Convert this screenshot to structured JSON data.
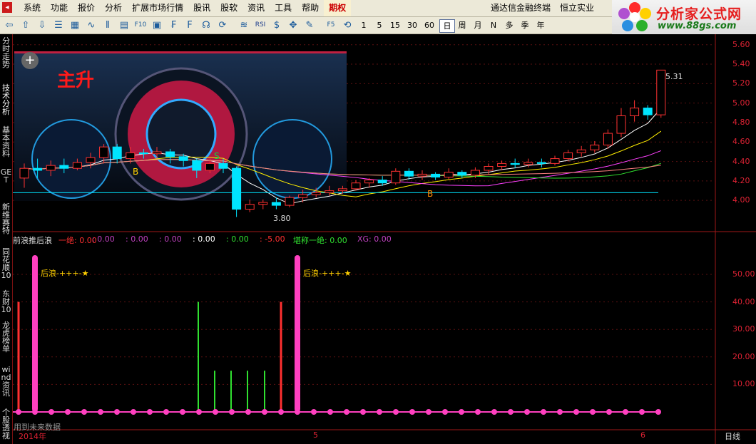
{
  "menu": {
    "back_icon": "back-arrow-icon",
    "items": [
      "系统",
      "功能",
      "报价",
      "分析",
      "扩展市场行情",
      "股讯",
      "股软",
      "资讯",
      "工具",
      "帮助"
    ],
    "highlight": "期权",
    "app_name": "通达信金融终端",
    "stock_name": "恒立实业"
  },
  "logo": {
    "main": "分析家公式网",
    "url": "www.88gs.com"
  },
  "toolbar": {
    "icons": [
      "back-icon",
      "up-arrow-icon",
      "down-arrow-icon",
      "list-icon",
      "grid-icon",
      "line-chart-icon",
      "candle-icon",
      "table-icon",
      "f10-icon",
      "detail-icon",
      "finance-icon",
      "f10-doc-icon",
      "news-icon",
      "refresh-icon",
      "wave-icon",
      "rsi-icon",
      "money-icon",
      "move-icon",
      "pen-icon",
      "f5-icon",
      "cycle-icon"
    ],
    "rsi_label": "RSI",
    "f5_label": "F5",
    "periods": [
      "1",
      "5",
      "15",
      "30",
      "60",
      "日",
      "周",
      "月",
      "N",
      "多",
      "季",
      "年"
    ],
    "selected_period": "日"
  },
  "sidebar": {
    "tabs": [
      "分时走势",
      "技术分析",
      "基本资料",
      "GET",
      "新维赛特",
      "同花顺10",
      "东财10",
      "龙虎榜单",
      "wind资讯",
      "个股透视"
    ],
    "selected": "技术分析"
  },
  "price_panel": {
    "high_label": "5.31",
    "low_label": "3.80",
    "buy_marks": [
      "B",
      "B"
    ],
    "sell_mark": "S",
    "overlay_title": "主升",
    "y_ticks": [
      "5.60",
      "5.40",
      "5.20",
      "5.00",
      "4.80",
      "4.60",
      "4.40",
      "4.20",
      "4.00"
    ]
  },
  "indicator_panel": {
    "name": "前浪推后浪",
    "readouts": [
      {
        "label": "一绝: 0.00",
        "color": "#ff3030"
      },
      {
        "label": ": 0.00",
        "color": "#c040c0"
      },
      {
        "label": ": 0.00",
        "color": "#c040c0"
      },
      {
        "label": ": 0.00",
        "color": "#c040c0"
      },
      {
        "label": ": 0.00",
        "color": "#ffffff"
      },
      {
        "label": ": 0.00",
        "color": "#30e030"
      },
      {
        "label": ": -5.00",
        "color": "#ff3030"
      },
      {
        "label": "堪称一绝: 0.00",
        "color": "#30e030"
      },
      {
        "label": "XG: 0.00",
        "color": "#c040c0"
      }
    ],
    "annotation": "后浪-+++-★",
    "future_note": "用到未来数据",
    "y_ticks": [
      "50.00",
      "40.00",
      "30.00",
      "20.00",
      "10.00"
    ]
  },
  "date_axis": {
    "year": "2014年",
    "months": [
      "5",
      "6"
    ]
  },
  "period_label": "日线",
  "colors": {
    "up": "#ff3232",
    "down": "#00e5ff",
    "bg": "#000000",
    "grid": "#8a1a1a"
  },
  "chart_data": [
    {
      "type": "candlestick",
      "title": "恒立实业 日线",
      "ylim": [
        3.8,
        5.65
      ],
      "series": [
        {
          "name": "price",
          "values": [
            [
              4.2,
              4.3,
              4.35,
              4.1
            ],
            [
              4.3,
              4.28,
              4.4,
              4.2
            ],
            [
              4.28,
              4.33,
              4.38,
              4.22
            ],
            [
              4.33,
              4.3,
              4.4,
              4.25
            ],
            [
              4.3,
              4.36,
              4.4,
              4.28
            ],
            [
              4.36,
              4.41,
              4.46,
              4.3
            ],
            [
              4.41,
              4.52,
              4.55,
              4.35
            ],
            [
              4.52,
              4.4,
              4.55,
              4.35
            ],
            [
              4.4,
              4.46,
              4.52,
              4.35
            ],
            [
              4.46,
              4.45,
              4.5,
              4.4
            ],
            [
              4.45,
              4.47,
              4.52,
              4.4
            ],
            [
              4.47,
              4.42,
              4.5,
              4.35
            ],
            [
              4.42,
              4.38,
              4.45,
              4.32
            ],
            [
              4.38,
              4.28,
              4.4,
              4.2
            ],
            [
              4.28,
              4.35,
              4.4,
              4.25
            ],
            [
              4.35,
              4.3,
              4.4,
              4.25
            ],
            [
              4.3,
              3.88,
              4.32,
              3.8
            ],
            [
              3.88,
              3.93,
              3.98,
              3.85
            ],
            [
              3.93,
              3.95,
              3.98,
              3.88
            ],
            [
              3.95,
              3.92,
              4.0,
              3.88
            ],
            [
              3.92,
              4.0,
              4.02,
              3.9
            ],
            [
              4.0,
              4.03,
              4.08,
              3.95
            ],
            [
              4.03,
              4.05,
              4.1,
              4.0
            ],
            [
              4.05,
              4.07,
              4.12,
              4.02
            ],
            [
              4.07,
              4.09,
              4.12,
              4.04
            ],
            [
              4.09,
              4.15,
              4.18,
              4.07
            ],
            [
              4.15,
              4.18,
              4.2,
              4.1
            ],
            [
              4.18,
              4.15,
              4.22,
              4.12
            ],
            [
              4.15,
              4.27,
              4.3,
              4.13
            ],
            [
              4.27,
              4.22,
              4.3,
              4.18
            ],
            [
              4.22,
              4.24,
              4.28,
              4.18
            ],
            [
              4.24,
              4.21,
              4.26,
              4.18
            ],
            [
              4.21,
              4.26,
              4.3,
              4.19
            ],
            [
              4.26,
              4.23,
              4.28,
              4.2
            ],
            [
              4.23,
              4.28,
              4.31,
              4.2
            ],
            [
              4.28,
              4.32,
              4.35,
              4.24
            ],
            [
              4.32,
              4.35,
              4.38,
              4.28
            ],
            [
              4.35,
              4.34,
              4.4,
              4.3
            ],
            [
              4.34,
              4.36,
              4.4,
              4.31
            ],
            [
              4.36,
              4.35,
              4.4,
              4.31
            ],
            [
              4.35,
              4.4,
              4.43,
              4.33
            ],
            [
              4.4,
              4.46,
              4.49,
              4.37
            ],
            [
              4.46,
              4.49,
              4.53,
              4.42
            ],
            [
              4.49,
              4.54,
              4.58,
              4.46
            ],
            [
              4.54,
              4.66,
              4.7,
              4.5
            ],
            [
              4.66,
              4.84,
              4.92,
              4.62
            ],
            [
              4.84,
              4.92,
              5.0,
              4.78
            ],
            [
              4.92,
              4.85,
              4.95,
              4.8
            ],
            [
              4.85,
              5.31,
              5.31,
              4.82
            ]
          ]
        }
      ]
    },
    {
      "type": "bar",
      "title": "前浪推后浪",
      "ylim": [
        0,
        60
      ],
      "series": [
        {
          "name": "一绝",
          "color": "#ff3030",
          "values": [
            [
              0,
              40
            ],
            [
              16,
              40
            ]
          ]
        },
        {
          "name": "堪称一绝",
          "color": "#30e030",
          "values": [
            [
              11,
              40
            ],
            [
              12,
              15
            ],
            [
              13,
              15
            ],
            [
              14,
              15
            ],
            [
              15,
              15
            ]
          ]
        },
        {
          "name": "XG",
          "color": "#ff40c0",
          "values": [
            [
              1,
              57
            ],
            [
              17,
              57
            ]
          ]
        }
      ]
    }
  ]
}
